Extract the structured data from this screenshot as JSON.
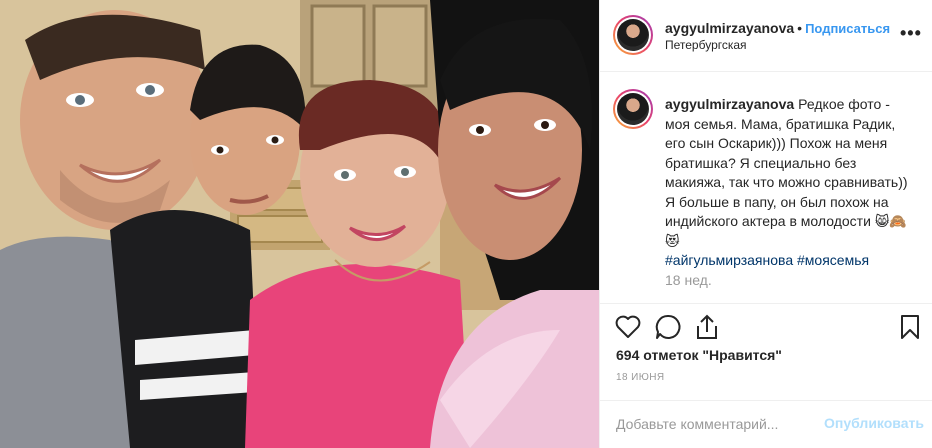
{
  "post": {
    "username": "aygyulmirzayanova",
    "dot": "•",
    "follow_label": "Подписаться",
    "location": "Петербургская",
    "more_label": "•••"
  },
  "caption": {
    "username": "aygyulmirzayanova",
    "text": "Редкое фото - моя семья. Мама, братишка Радик, его сын Оскарик))) Похож на меня братишка? Я специально без макияжа, так что можно сравнивать)) Я больше в папу, он был похож на индийского актера в молодости 😸🙈😻",
    "hashtags": [
      "#айгульмирзаянова",
      "#моясемья"
    ],
    "time_ago": "18 нед."
  },
  "icons": {
    "like": "heart-icon",
    "comment": "comment-icon",
    "share": "share-icon",
    "save": "bookmark-icon"
  },
  "likes": "694 отметок \"Нравится\"",
  "date": "18 ИЮНЯ",
  "comment_box": {
    "placeholder": "Добавьте комментарий...",
    "publish_label": "Опубликовать"
  },
  "colors": {
    "link": "#3897f0",
    "publish_disabled": "#b2dffc",
    "hashtag": "#003569",
    "muted": "#999999"
  }
}
